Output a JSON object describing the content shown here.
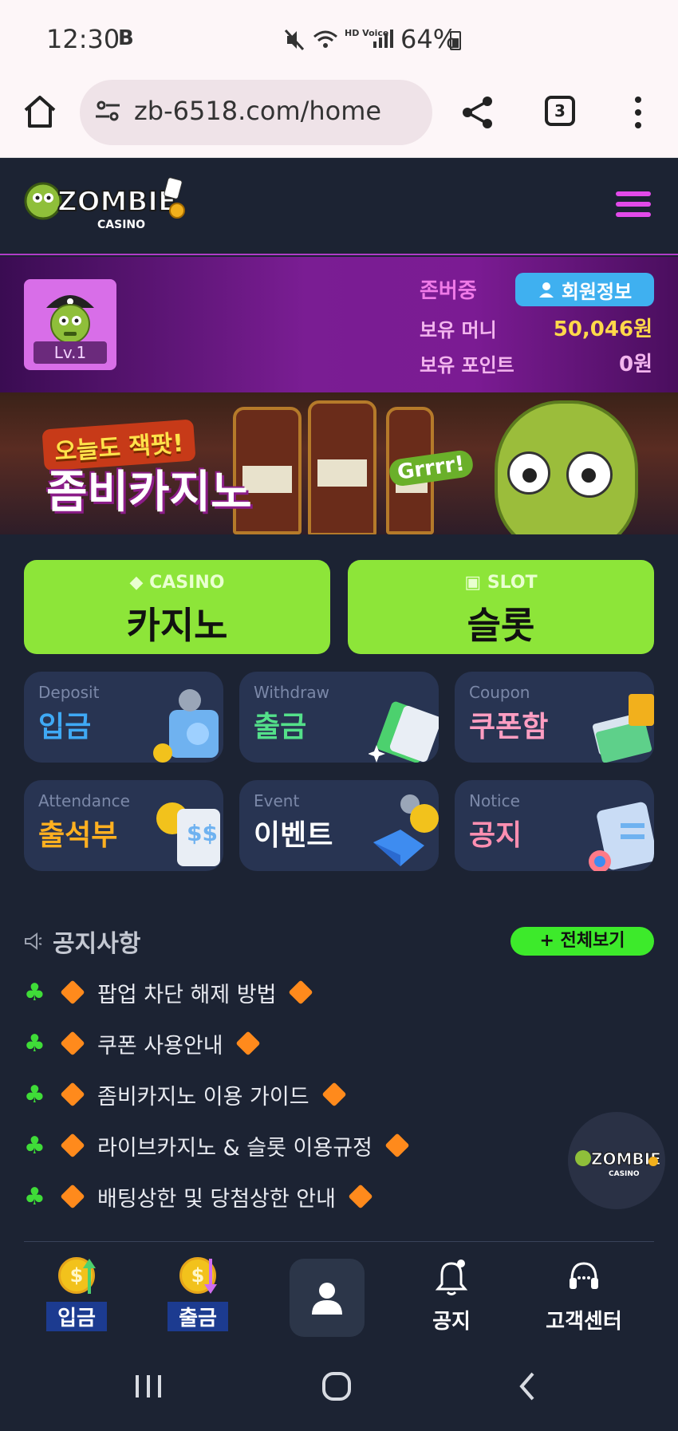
{
  "status_bar": {
    "time": "12:30",
    "battery": "64%",
    "hd_label": "HD Voice"
  },
  "browser": {
    "url": "zb-6518.com/home",
    "tab_count": "3"
  },
  "profile": {
    "level": "Lv.1",
    "username": "존버중",
    "member_button": "회원정보",
    "money_label": "보유 머니",
    "money_value": "50,046원",
    "points_label": "보유 포인트",
    "points_value": "0원"
  },
  "banner": {
    "tagline": "오늘도 잭팟!",
    "title": "좀비카지노",
    "bubble": "Grrrr!"
  },
  "games": [
    {
      "sub": "CASINO",
      "label": "카지노"
    },
    {
      "sub": "SLOT",
      "label": "슬롯"
    }
  ],
  "tiles": [
    {
      "en": "Deposit",
      "ko": "입금",
      "color": "#3fa9f5"
    },
    {
      "en": "Withdraw",
      "ko": "출금",
      "color": "#54e08a"
    },
    {
      "en": "Coupon",
      "ko": "쿠폰함",
      "color": "#ff9ec2"
    },
    {
      "en": "Attendance",
      "ko": "출석부",
      "color": "#ffb020"
    },
    {
      "en": "Event",
      "ko": "이벤트",
      "color": "#ffffff"
    },
    {
      "en": "Notice",
      "ko": "공지",
      "color": "#ff8fb1"
    }
  ],
  "notices": {
    "heading": "공지사항",
    "view_all": "+ 전체보기",
    "items": [
      "팝업 차단 해제 방법",
      "쿠폰 사용안내",
      "좀비카지노 이용 가이드",
      "라이브카지노 & 슬롯 이용규정",
      "배팅상한 및 당첨상한 안내"
    ]
  },
  "bottom_nav": [
    {
      "label": "입금"
    },
    {
      "label": "출금"
    },
    {
      "label": "공지"
    },
    {
      "label": "고객센터"
    }
  ],
  "logo": {
    "line1": "ZOMBIE",
    "line2": "CASINO"
  }
}
